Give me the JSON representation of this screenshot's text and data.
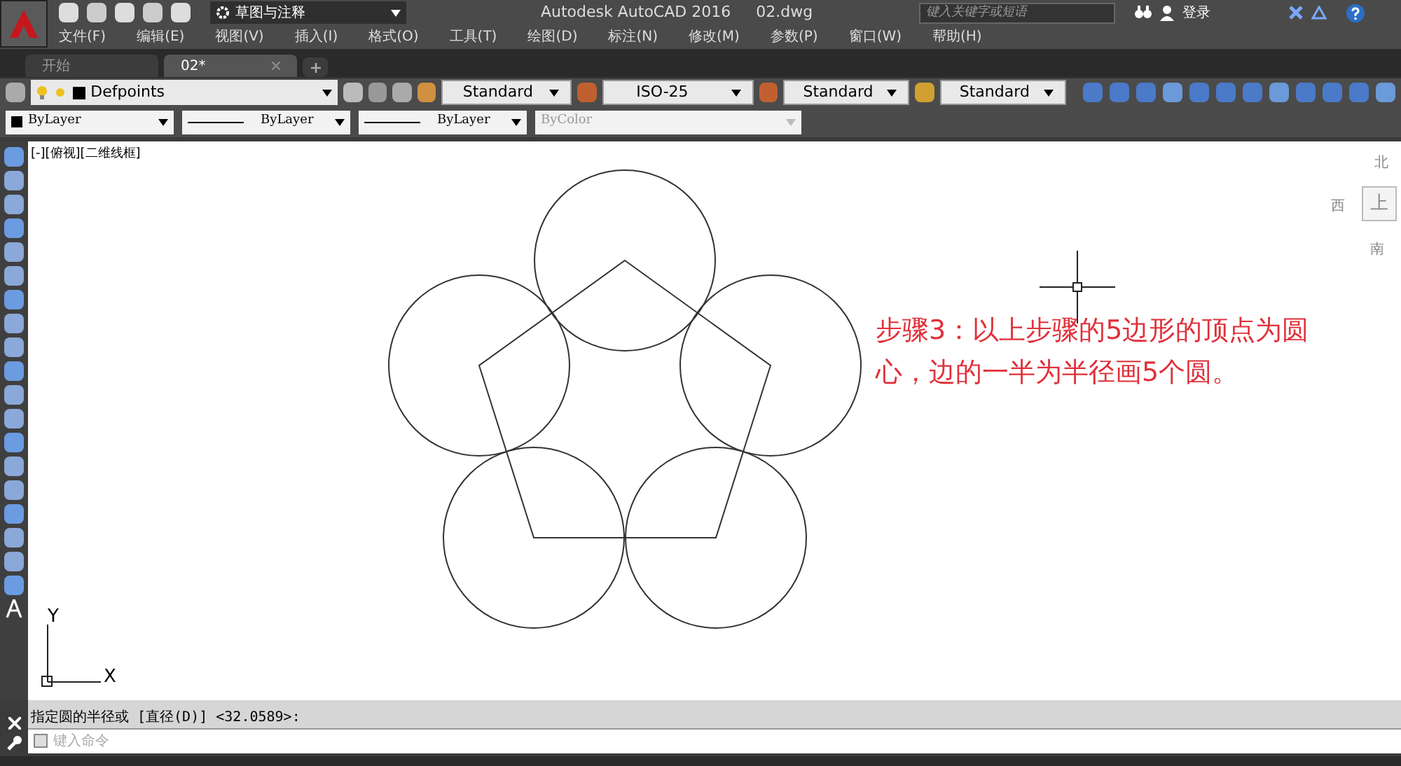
{
  "title_bar": {
    "workspace": "草图与注释",
    "app_title": "Autodesk AutoCAD 2016",
    "file_name": "02.dwg",
    "search": {
      "placeholder": "键入关键字或短语"
    },
    "login": "登录"
  },
  "menu": [
    "文件(F)",
    "编辑(E)",
    "视图(V)",
    "插入(I)",
    "格式(O)",
    "工具(T)",
    "绘图(D)",
    "标注(N)",
    "修改(M)",
    "参数(P)",
    "窗口(W)",
    "帮助(H)"
  ],
  "tabs": [
    {
      "label": "开始",
      "selected": false
    },
    {
      "label": "02*",
      "selected": true
    }
  ],
  "toolbar": {
    "layer": "Defpoints",
    "text_style": "Standard",
    "dim_style": "ISO-25",
    "table_style": "Standard",
    "multileader_style": "Standard"
  },
  "properties": [
    {
      "value": "ByLayer",
      "kind": "color",
      "disabled": false
    },
    {
      "value": "ByLayer",
      "kind": "line",
      "disabled": false
    },
    {
      "value": "ByLayer",
      "kind": "line",
      "disabled": false
    },
    {
      "value": "ByColor",
      "kind": "plain",
      "disabled": true
    }
  ],
  "viewport_label": "[-][俯视][二维线框]",
  "viewcube": {
    "north": "北",
    "west": "西",
    "top": "上",
    "south": "南"
  },
  "ucs": {
    "y": "Y",
    "x": "X"
  },
  "annotation": "步骤3：以上步骤的5边形的顶点为圆心，边的一半为半径画5个圆。",
  "command": {
    "history": "指定圆的半径或 [直径(D)] <32.0589>:",
    "placeholder": "键入命令"
  }
}
